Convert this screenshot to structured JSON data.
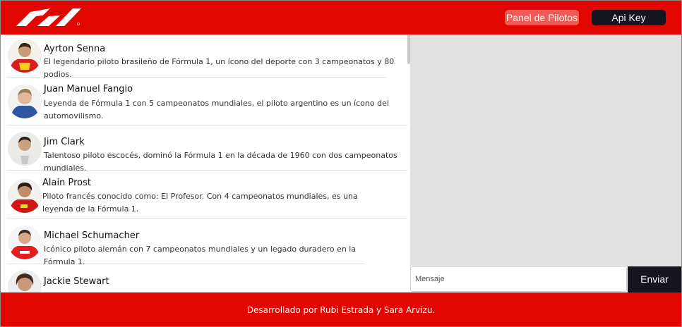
{
  "header": {
    "logo_name": "F1",
    "panel_button": "Panel de Pilotos",
    "api_button": "Api Key"
  },
  "drivers": [
    {
      "name": "Ayrton Senna",
      "desc": "El legendario piloto brasileño de Fórmula 1, un ícono del deporte con 3 campeonatos y 80 podios."
    },
    {
      "name": "Juan Manuel Fangio",
      "desc": "Leyenda de Fórmula 1 con 5 campeonatos mundiales, el piloto argentino es un ícono del automovilismo."
    },
    {
      "name": "Jim Clark",
      "desc": "Talentoso piloto escocés, dominó la Fórmula 1 en la década de 1960 con dos campeonatos mundiales."
    },
    {
      "name": "Alain Prost",
      "desc": "Piloto francés conocido como: El Profesor. Con 4 campeonatos mundiales, es una leyenda de la Fórmula 1."
    },
    {
      "name": "Michael Schumacher",
      "desc": "Icónico piloto alemán con 7 campeonatos mundiales y un legado duradero en la Fórmula 1."
    },
    {
      "name": "Jackie Stewart",
      "desc": ""
    }
  ],
  "chat": {
    "placeholder": "Mensaje",
    "send_button": "Enviar"
  },
  "footer": {
    "text": "Desarrollado por Rubi Estrada y Sara Arvizu."
  },
  "colors": {
    "brand_red": "#e10600",
    "dark": "#15151e",
    "panel_button_bg": "#ef5a55",
    "chat_bg": "#e2e1e2"
  }
}
